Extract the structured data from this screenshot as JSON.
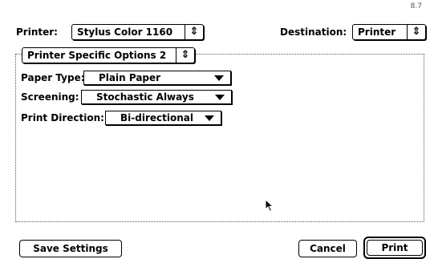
{
  "version": "8.7",
  "printer": {
    "label": "Printer:",
    "value": "Stylus Color 1160"
  },
  "destination": {
    "label": "Destination:",
    "value": "Printer"
  },
  "panel_menu": {
    "value": "Printer Specific Options 2"
  },
  "options": {
    "paper_type": {
      "label": "Paper Type:",
      "value": "Plain Paper"
    },
    "screening": {
      "label": "Screening:",
      "value": "Stochastic Always"
    },
    "print_direction": {
      "label": "Print Direction:",
      "value": "Bi-directional"
    }
  },
  "buttons": {
    "save": "Save Settings",
    "cancel": "Cancel",
    "print": "Print"
  },
  "icons": {
    "popup_arrows": "⇕",
    "cursor": "arrow-cursor"
  }
}
